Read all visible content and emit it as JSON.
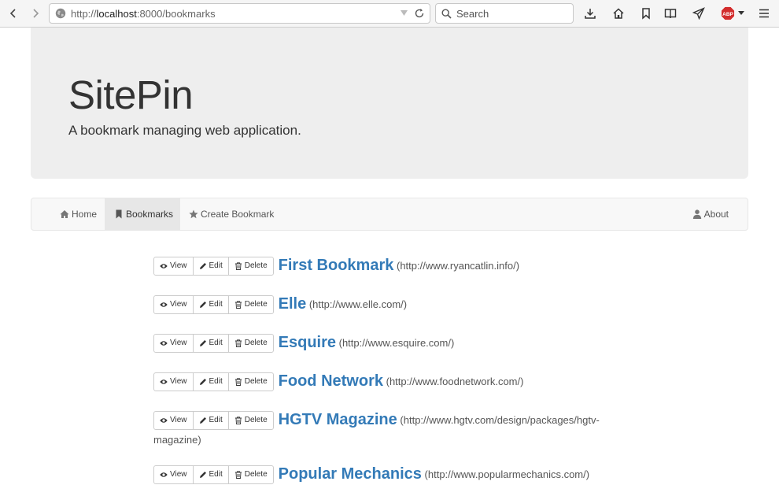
{
  "browser": {
    "url_prefix": "http://",
    "url_host": "localhost",
    "url_rest": ":8000/bookmarks",
    "search_placeholder": "Search",
    "abp_label": "ABP"
  },
  "jumbotron": {
    "title": "SitePin",
    "tagline": "A bookmark managing web application."
  },
  "nav": {
    "home": "Home",
    "bookmarks": "Bookmarks",
    "create": "Create Bookmark",
    "about": "About"
  },
  "actions": {
    "view": "View",
    "edit": "Edit",
    "delete": "Delete"
  },
  "bookmarks": [
    {
      "title": "First Bookmark",
      "url": "(http://www.ryancatlin.info/)"
    },
    {
      "title": "Elle",
      "url": "(http://www.elle.com/)"
    },
    {
      "title": "Esquire",
      "url": "(http://www.esquire.com/)"
    },
    {
      "title": "Food Network",
      "url": "(http://www.foodnetwork.com/)"
    },
    {
      "title": "HGTV Magazine",
      "url": "(http://www.hgtv.com/design/packages/hgtv-magazine)"
    },
    {
      "title": "Popular Mechanics",
      "url": "(http://www.popularmechanics.com/)"
    }
  ]
}
